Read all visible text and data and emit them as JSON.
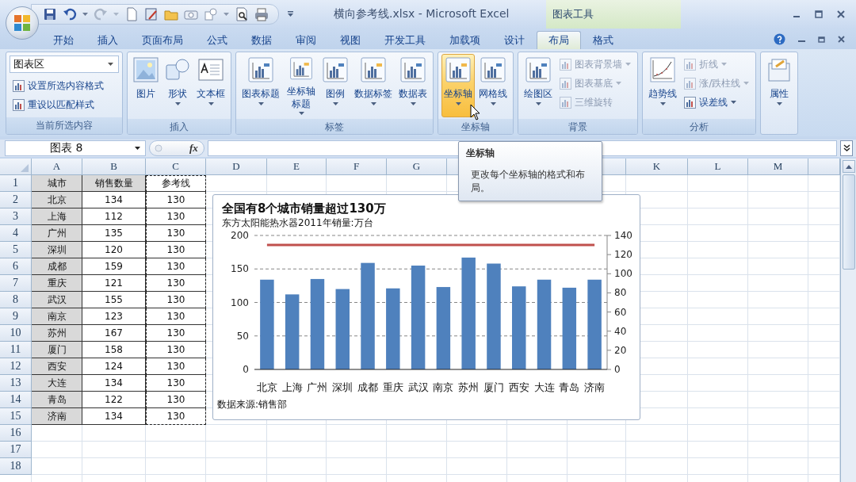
{
  "window": {
    "title": "横向参考线.xlsx - Microsoft Excel",
    "contextual_tab_group": "图表工具"
  },
  "tabs": [
    {
      "label": "开始",
      "selected": false
    },
    {
      "label": "插入",
      "selected": false
    },
    {
      "label": "页面布局",
      "selected": false
    },
    {
      "label": "公式",
      "selected": false
    },
    {
      "label": "数据",
      "selected": false
    },
    {
      "label": "审阅",
      "selected": false
    },
    {
      "label": "视图",
      "selected": false
    },
    {
      "label": "开发工具",
      "selected": false
    },
    {
      "label": "加载项",
      "selected": false
    },
    {
      "label": "设计",
      "selected": false
    },
    {
      "label": "布局",
      "selected": true
    },
    {
      "label": "格式",
      "selected": false
    }
  ],
  "ribbon": {
    "groups": [
      {
        "label": "当前所选内容",
        "items": [
          {
            "kind": "dropdown",
            "label": "图表区",
            "disabled": false,
            "hovered": false,
            "menu": true
          },
          {
            "kind": "small",
            "label": "设置所选内容格式",
            "disabled": false,
            "hovered": false,
            "menu": false
          },
          {
            "kind": "small",
            "label": "重设以匹配样式",
            "disabled": false,
            "hovered": false,
            "menu": false
          }
        ]
      },
      {
        "label": "插入",
        "items": [
          {
            "kind": "large",
            "label": "图片",
            "disabled": false,
            "hovered": false,
            "menu": false
          },
          {
            "kind": "large",
            "label": "形状",
            "disabled": false,
            "hovered": false,
            "menu": true
          },
          {
            "kind": "large",
            "label": "文本框",
            "disabled": false,
            "hovered": false,
            "menu": true
          }
        ]
      },
      {
        "label": "标签",
        "items": [
          {
            "kind": "large",
            "label": "图表标题",
            "disabled": false,
            "hovered": false,
            "menu": true
          },
          {
            "kind": "large",
            "label": "坐标轴标题",
            "disabled": false,
            "hovered": false,
            "menu": true
          },
          {
            "kind": "large",
            "label": "图例",
            "disabled": false,
            "hovered": false,
            "menu": true
          },
          {
            "kind": "large",
            "label": "数据标签",
            "disabled": false,
            "hovered": false,
            "menu": true
          },
          {
            "kind": "large",
            "label": "数据表",
            "disabled": false,
            "hovered": false,
            "menu": true
          }
        ]
      },
      {
        "label": "坐标轴",
        "items": [
          {
            "kind": "large",
            "label": "坐标轴",
            "disabled": false,
            "hovered": true,
            "menu": true
          },
          {
            "kind": "large",
            "label": "网格线",
            "disabled": false,
            "hovered": false,
            "menu": true
          }
        ]
      },
      {
        "label": "背景",
        "items": [
          {
            "kind": "large",
            "label": "绘图区",
            "disabled": false,
            "hovered": false,
            "menu": true
          },
          {
            "kind": "small",
            "label": "图表背景墙",
            "disabled": true,
            "hovered": false,
            "menu": true
          },
          {
            "kind": "small",
            "label": "图表基底",
            "disabled": true,
            "hovered": false,
            "menu": true
          },
          {
            "kind": "small",
            "label": "三维旋转",
            "disabled": true,
            "hovered": false,
            "menu": false
          }
        ]
      },
      {
        "label": "分析",
        "items": [
          {
            "kind": "large",
            "label": "趋势线",
            "disabled": false,
            "hovered": false,
            "menu": true
          },
          {
            "kind": "small",
            "label": "折线",
            "disabled": true,
            "hovered": false,
            "menu": true
          },
          {
            "kind": "small",
            "label": "涨/跌柱线",
            "disabled": true,
            "hovered": false,
            "menu": true
          },
          {
            "kind": "small",
            "label": "误差线",
            "disabled": false,
            "hovered": false,
            "menu": true
          }
        ]
      },
      {
        "items": [
          {
            "kind": "large",
            "label": "属性",
            "disabled": false,
            "hovered": false,
            "menu": true
          }
        ]
      }
    ]
  },
  "formula_bar": {
    "name_box": "图表 8",
    "function_button": "fx"
  },
  "sheet": {
    "columns": [
      "A",
      "B",
      "C",
      "D",
      "E",
      "F",
      "G"
    ],
    "columns_right": [
      "K",
      "L",
      "M"
    ],
    "rows": [
      {
        "number": "1",
        "cells": [
          "城市",
          "销售数量",
          "参考线"
        ]
      },
      {
        "number": "2",
        "cells": [
          "北京",
          "134",
          "130"
        ]
      },
      {
        "number": "3",
        "cells": [
          "上海",
          "112",
          "130"
        ]
      },
      {
        "number": "4",
        "cells": [
          "广州",
          "135",
          "130"
        ]
      },
      {
        "number": "5",
        "cells": [
          "深圳",
          "120",
          "130"
        ]
      },
      {
        "number": "6",
        "cells": [
          "成都",
          "159",
          "130"
        ]
      },
      {
        "number": "7",
        "cells": [
          "重庆",
          "121",
          "130"
        ]
      },
      {
        "number": "8",
        "cells": [
          "武汉",
          "155",
          "130"
        ]
      },
      {
        "number": "9",
        "cells": [
          "南京",
          "123",
          "130"
        ]
      },
      {
        "number": "10",
        "cells": [
          "苏州",
          "167",
          "130"
        ]
      },
      {
        "number": "11",
        "cells": [
          "厦门",
          "158",
          "130"
        ]
      },
      {
        "number": "12",
        "cells": [
          "西安",
          "124",
          "130"
        ]
      },
      {
        "number": "13",
        "cells": [
          "大连",
          "134",
          "130"
        ]
      },
      {
        "number": "14",
        "cells": [
          "青岛",
          "122",
          "130"
        ]
      },
      {
        "number": "15",
        "cells": [
          "济南",
          "134",
          "130"
        ]
      },
      {
        "number": "16"
      },
      {
        "number": "17"
      },
      {
        "number": "18"
      }
    ]
  },
  "chart": {
    "subtitle": "东方太阳能热水器2011年销量:万台",
    "source": "数据来源:销售部",
    "chart_data": {
      "type": "bar",
      "title": "全国有8个城市销量超过130万",
      "categories": [
        "北京",
        "上海",
        "广州",
        "深圳",
        "成都",
        "重庆",
        "武汉",
        "南京",
        "苏州",
        "厦门",
        "西安",
        "大连",
        "青岛",
        "济南"
      ],
      "series": [
        {
          "color": "#4f81bd",
          "values": [
            134,
            112,
            135,
            120,
            159,
            121,
            155,
            123,
            167,
            158,
            124,
            134,
            122,
            134
          ]
        },
        {
          "type": "line",
          "axis": "y2",
          "color": "#c0504d",
          "values": [
            130,
            130,
            130,
            130,
            130,
            130,
            130,
            130,
            130,
            130,
            130,
            130,
            130,
            130
          ]
        }
      ],
      "grid": true,
      "ylim": [
        0,
        200
      ],
      "yticks": [
        0,
        50,
        100,
        150,
        200
      ],
      "y2lim": [
        0,
        140
      ],
      "y2ticks": [
        0,
        20,
        40,
        60,
        80,
        100,
        120,
        140
      ]
    }
  },
  "tooltip": {
    "title": "坐标轴",
    "text": "更改每个坐标轴的格式和布局。"
  }
}
